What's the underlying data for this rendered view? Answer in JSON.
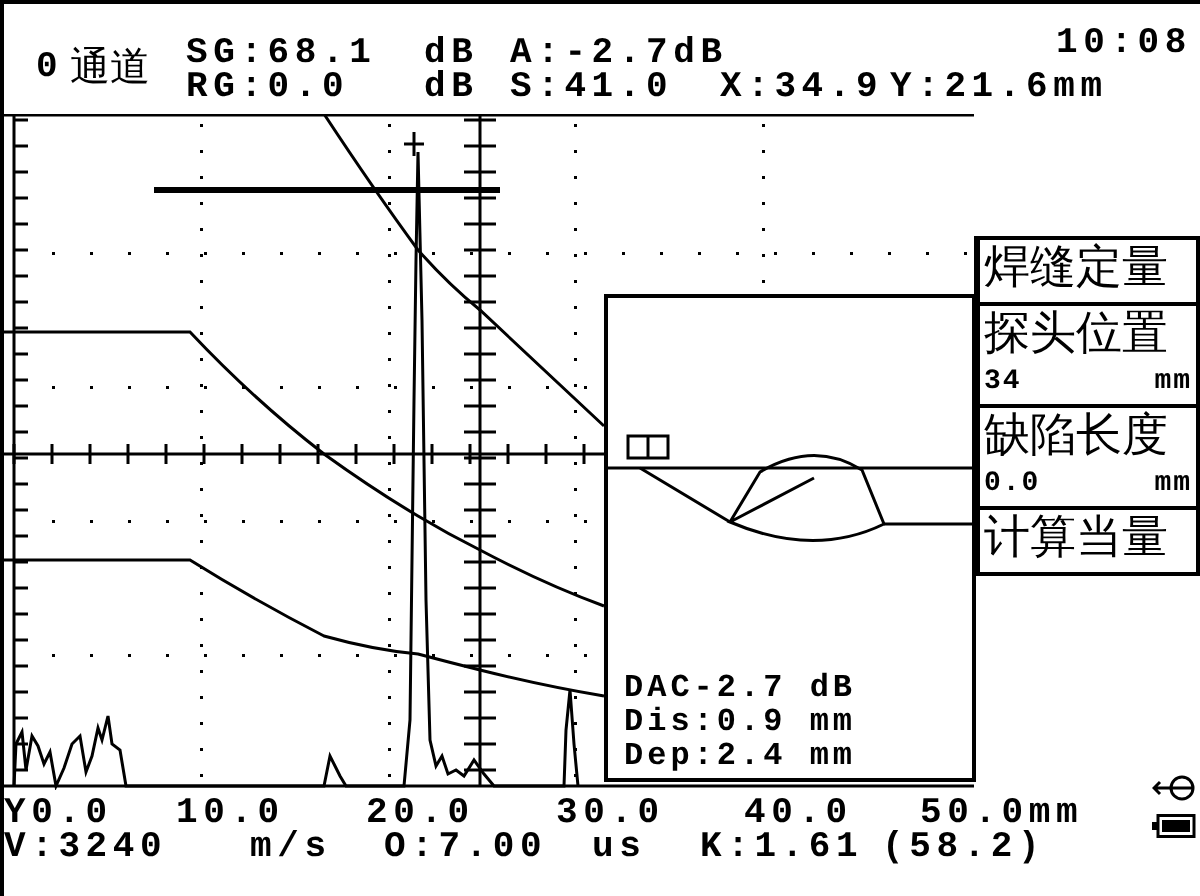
{
  "channel": {
    "number": "0",
    "label": "通道"
  },
  "readouts": [
    [
      "SG:68.1",
      "dB",
      "A:-2.7dB"
    ],
    [
      "RG:0.0",
      "dB",
      "S:41.0",
      "X:34.9",
      "Y:21.6mm"
    ]
  ],
  "time": "10:08",
  "menu": [
    {
      "title": "焊缝定量"
    },
    {
      "title": "探头位置",
      "value": "34",
      "unit": "mm"
    },
    {
      "title": "缺陷长度",
      "value": "0.0",
      "unit": "mm"
    },
    {
      "title": "计算当量"
    }
  ],
  "flaw_panel": {
    "lines": [
      "DAC-2.7 dB",
      "Dis:0.9 mm",
      "Dep:2.4 mm"
    ]
  },
  "axis_labels": [
    "Y0.0",
    "10.0",
    "20.0",
    "30.0",
    "40.0",
    "50.0mm"
  ],
  "status": [
    "V:3240",
    "m/s",
    "O:7.00",
    "us",
    "K:1.61",
    "(58.2)"
  ]
}
